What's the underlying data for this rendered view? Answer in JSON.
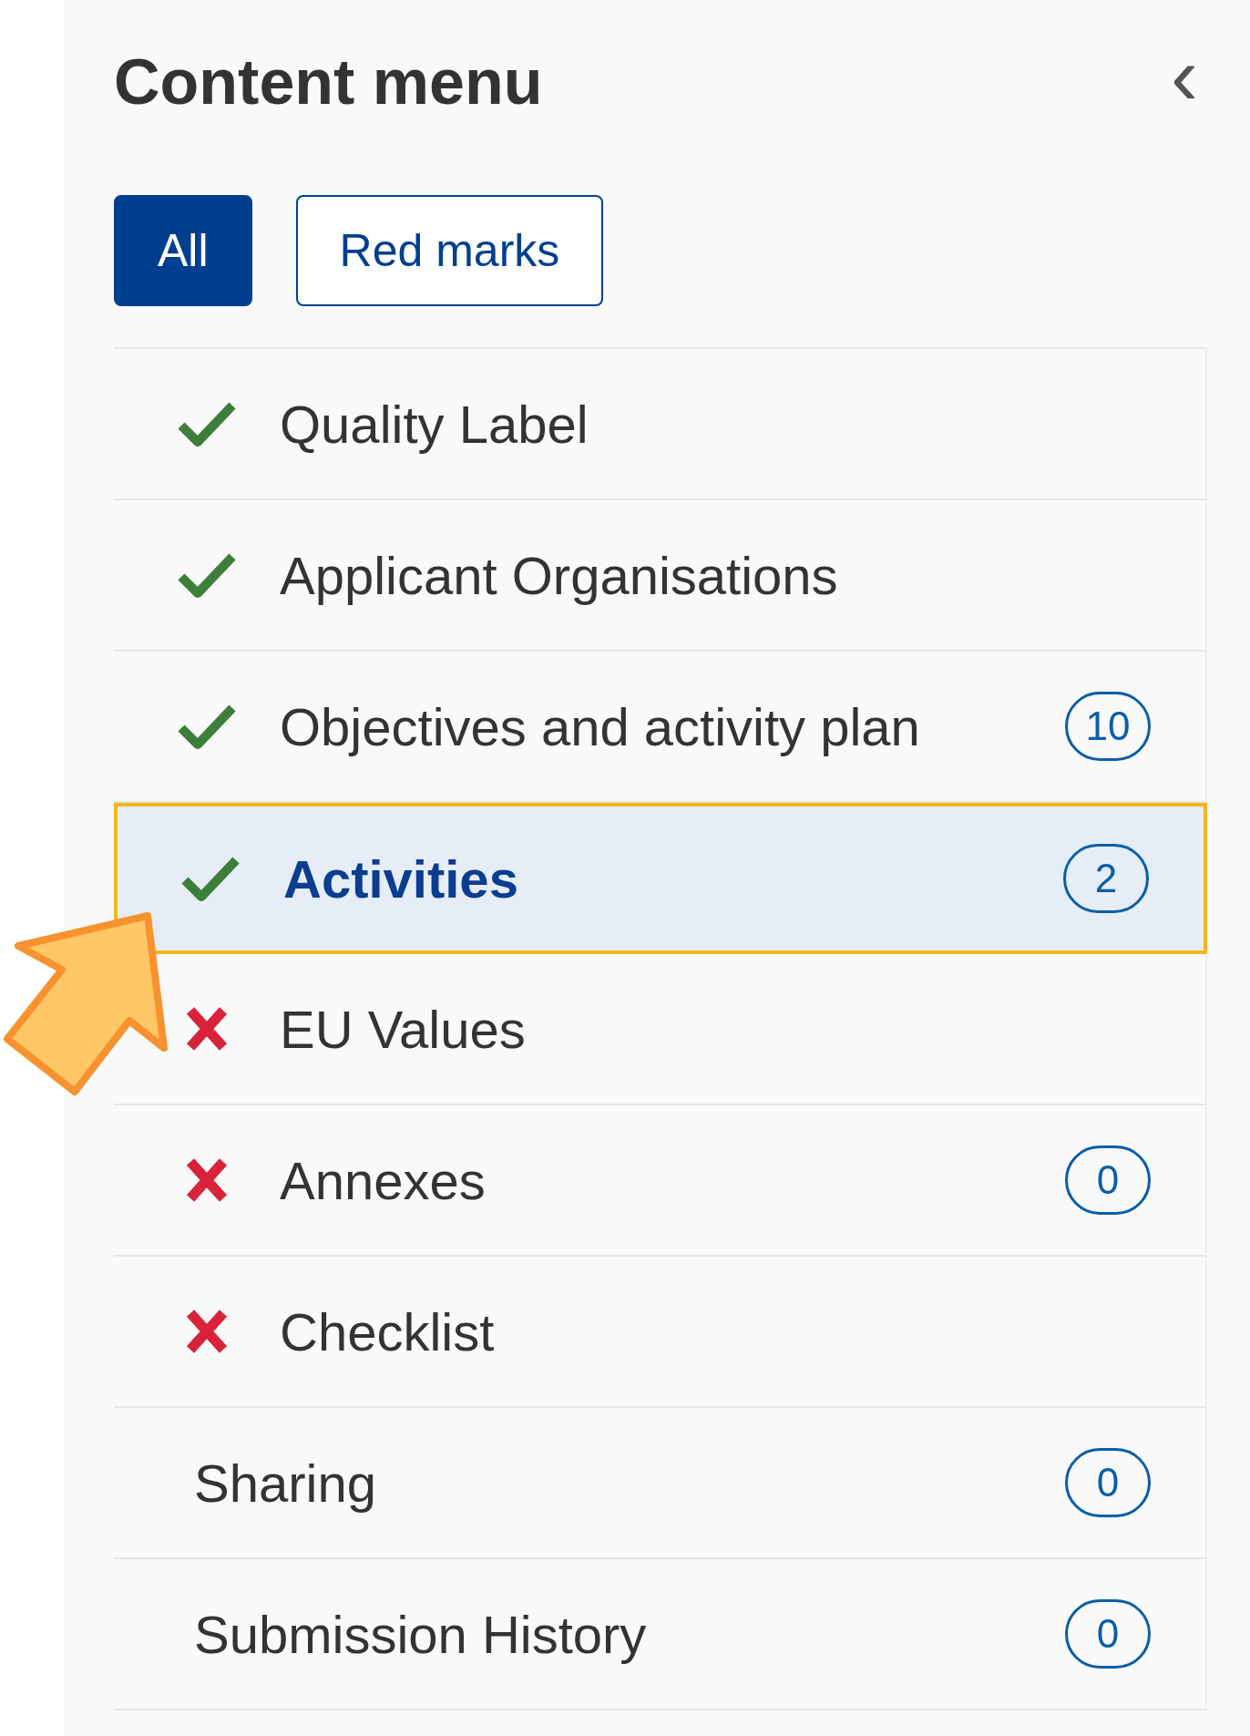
{
  "title": "Content menu",
  "collapse": {
    "glyph": "‹"
  },
  "filters": [
    {
      "label": "All",
      "selected": true
    },
    {
      "label": "Red marks",
      "selected": false
    }
  ],
  "items": [
    {
      "label": "Quality Label",
      "kind": "done",
      "selected": false
    },
    {
      "label": "Applicant Organisations",
      "kind": "done",
      "selected": false
    },
    {
      "label": "Objectives and activity plan",
      "kind": "done",
      "badge": "10",
      "selected": false
    },
    {
      "label": "Activities",
      "kind": "done",
      "badge": "2",
      "selected": true
    },
    {
      "label": "EU Values",
      "kind": "error",
      "selected": false
    },
    {
      "label": "Annexes",
      "kind": "error",
      "badge": "0",
      "selected": false
    },
    {
      "label": "Checklist",
      "kind": "error",
      "selected": false
    },
    {
      "label": "Sharing",
      "kind": "none",
      "badge": "0",
      "selected": false
    },
    {
      "label": "Submission History",
      "kind": "none",
      "badge": "0",
      "selected": false
    }
  ],
  "pointer": {
    "kind": "arrow"
  }
}
